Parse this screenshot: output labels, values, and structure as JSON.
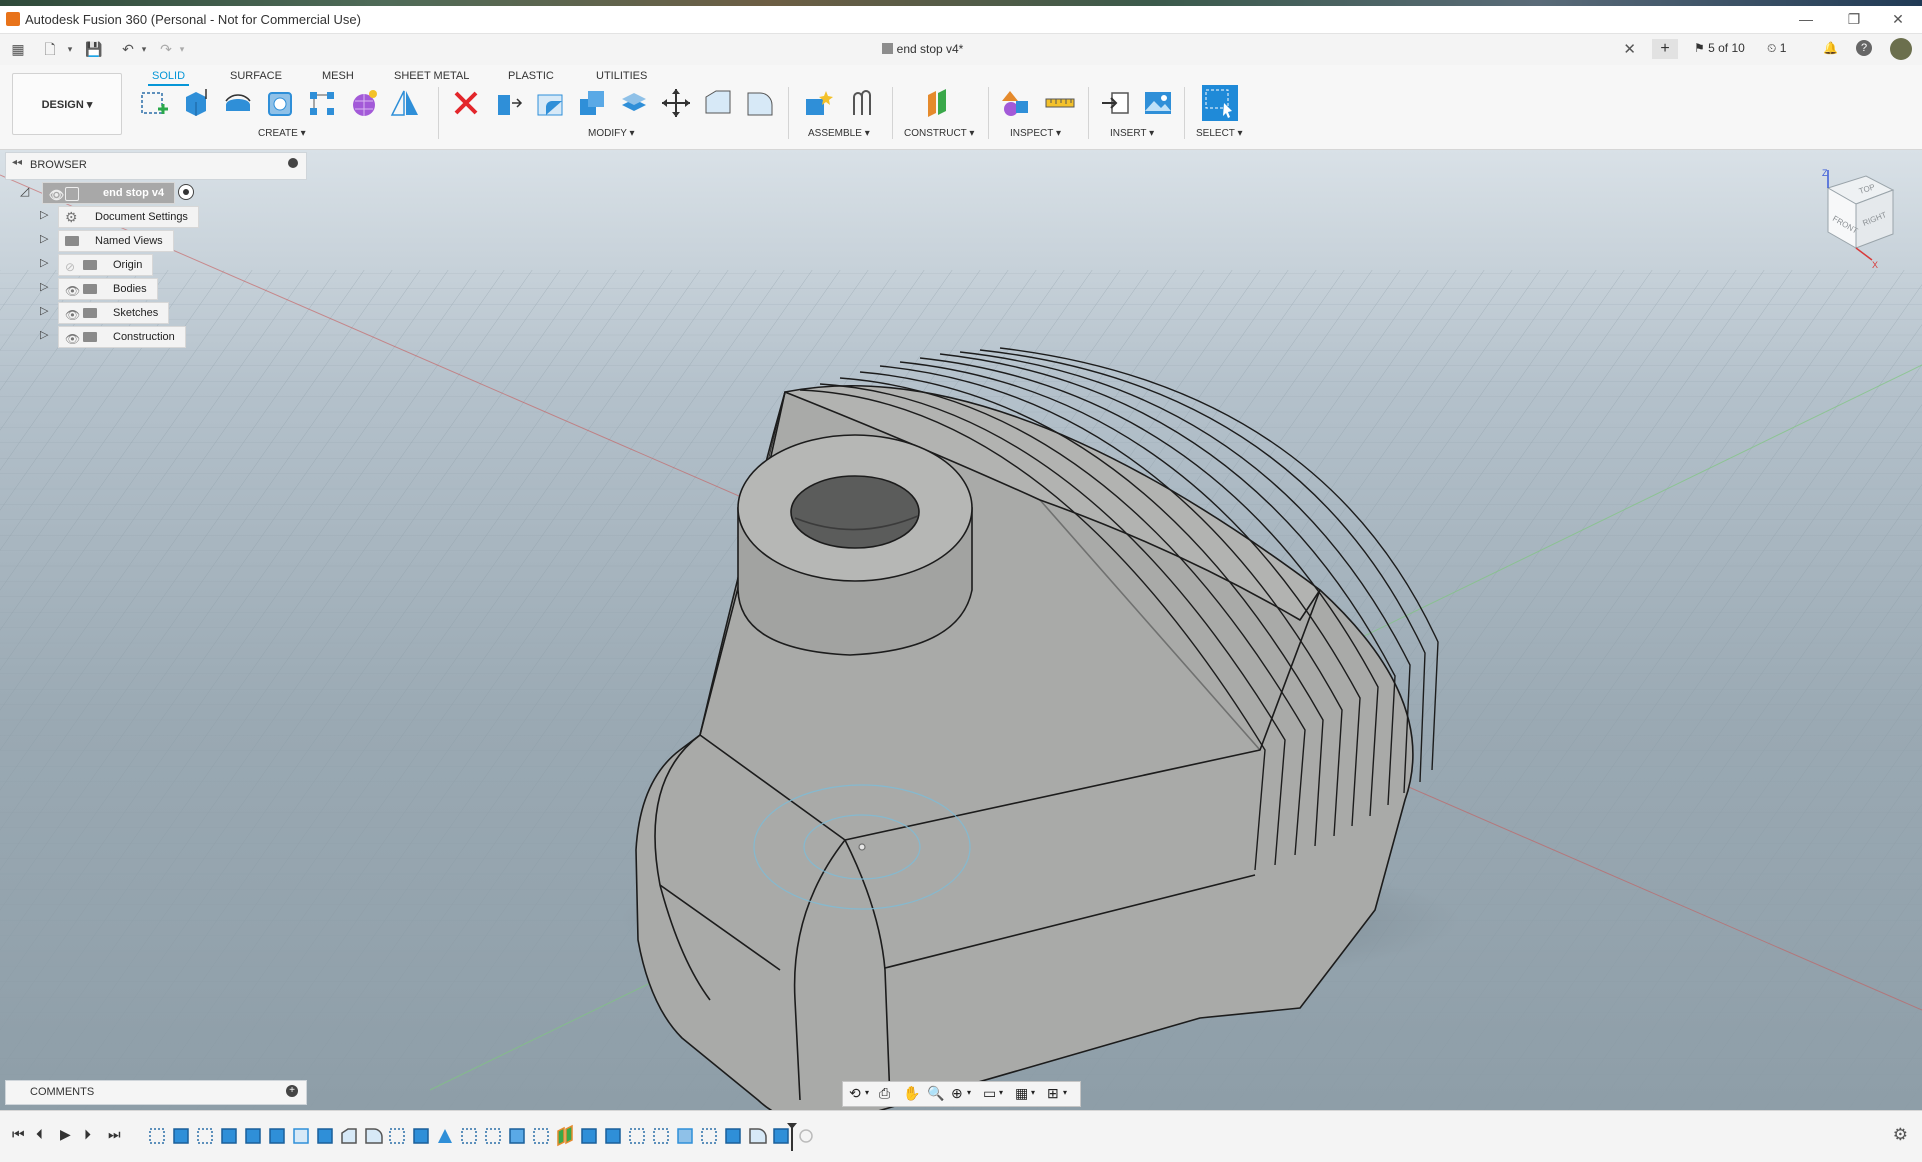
{
  "window": {
    "title": "Autodesk Fusion 360 (Personal - Not for Commercial Use)",
    "minimize": "—",
    "restore": "❐",
    "close": "✕"
  },
  "document": {
    "tab_title": "end stop v4*",
    "version": "5 of 10",
    "jobs": "1"
  },
  "ribbon": {
    "workspace": "DESIGN",
    "tabs": [
      {
        "label": "SOLID",
        "active": true
      },
      {
        "label": "SURFACE",
        "active": false
      },
      {
        "label": "MESH",
        "active": false
      },
      {
        "label": "SHEET METAL",
        "active": false
      },
      {
        "label": "PLASTIC",
        "active": false
      },
      {
        "label": "UTILITIES",
        "active": false
      }
    ],
    "groups": [
      {
        "label": "CREATE ▾"
      },
      {
        "label": "MODIFY ▾"
      },
      {
        "label": "ASSEMBLE ▾"
      },
      {
        "label": "CONSTRUCT ▾"
      },
      {
        "label": "INSPECT ▾"
      },
      {
        "label": "INSERT ▾"
      },
      {
        "label": "SELECT ▾"
      }
    ]
  },
  "browser": {
    "title": "BROWSER",
    "root": "end stop v4",
    "items": [
      {
        "label": "Document Settings",
        "icon": "gear-icon"
      },
      {
        "label": "Named Views",
        "icon": "folder-icon"
      },
      {
        "label": "Origin",
        "icon": "folder-icon"
      },
      {
        "label": "Bodies",
        "icon": "folder-icon"
      },
      {
        "label": "Sketches",
        "icon": "folder-icon"
      },
      {
        "label": "Construction",
        "icon": "folder-icon"
      }
    ]
  },
  "comments": {
    "title": "COMMENTS"
  },
  "viewcube": {
    "top": "TOP",
    "front": "FRONT",
    "right": "RIGHT",
    "axis_z": "Z",
    "axis_x": "X"
  },
  "colors": {
    "accent": "#0696d7",
    "model_fill": "#a9a9a7",
    "grid": "#8797a1"
  }
}
